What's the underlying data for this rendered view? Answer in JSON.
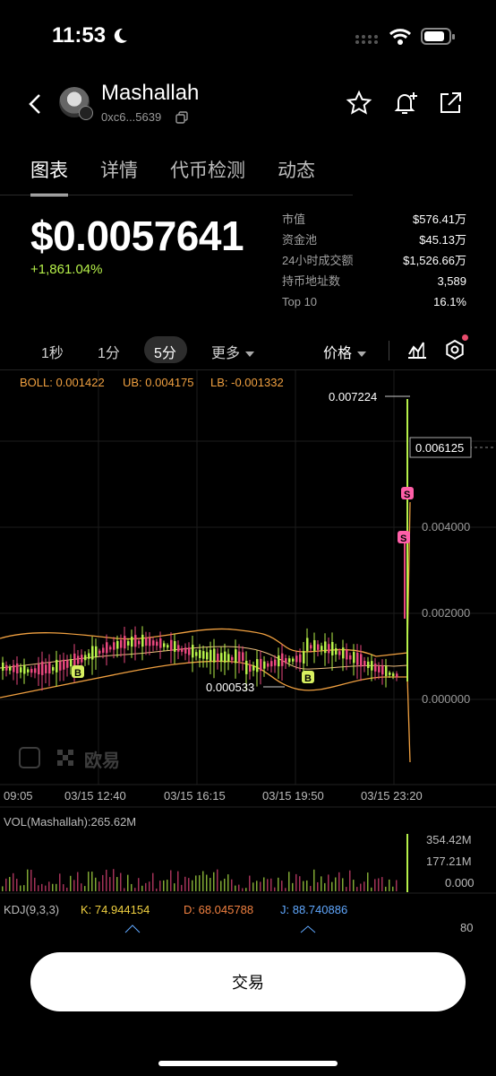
{
  "status": {
    "time": "11:53"
  },
  "header": {
    "name": "Mashallah",
    "address": "0xc6...5639"
  },
  "tabs": [
    {
      "label": "图表",
      "active": true
    },
    {
      "label": "详情",
      "active": false
    },
    {
      "label": "代币检测",
      "active": false
    },
    {
      "label": "动态",
      "active": false
    }
  ],
  "price": {
    "value": "$0.0057641",
    "change": "+1,861.04%",
    "change_color": "#b6f04a"
  },
  "stats": [
    {
      "label": "市值",
      "value": "$576.41万"
    },
    {
      "label": "资金池",
      "value": "$45.13万"
    },
    {
      "label": "24小时成交额",
      "value": "$1,526.66万"
    },
    {
      "label": "持币地址数",
      "value": "3,589"
    },
    {
      "label": "Top 10",
      "value": "16.1%"
    }
  ],
  "timeframes": {
    "t1": "1秒",
    "t2": "1分",
    "t3": "5分",
    "more": "更多",
    "price_type": "价格"
  },
  "indicators": {
    "boll": "BOLL: 0.001422",
    "ub": "UB: 0.004175",
    "lb": "LB: -0.001332",
    "vol": "VOL(Mashallah):265.62M",
    "kdj_label": "KDJ(9,3,3)",
    "kdj_k": "K: 74.944154",
    "kdj_d": "D: 68.045788",
    "kdj_j": "J: 88.740886"
  },
  "chart": {
    "y_ticks": [
      "0.004000",
      "0.002000",
      "0.000000"
    ],
    "max_label": "0.007224",
    "min_label": "0.000533",
    "current_label": "0.006125",
    "x_ticks": [
      "09:05",
      "03/15 12:40",
      "03/15 16:15",
      "03/15 19:50",
      "03/15 23:20"
    ],
    "vol_ticks": [
      "354.42M",
      "177.21M",
      "0.000"
    ],
    "kdj_tick": "80",
    "watermark": "欧易",
    "buy_marker": "B",
    "sell_marker": "S",
    "colors": {
      "up": "#b6f04a",
      "down": "#e8477e",
      "boll": "#f0a040"
    }
  },
  "chart_data": {
    "type": "line",
    "title": "",
    "series": [
      {
        "name": "BOLL",
        "values": [
          0.001422
        ]
      },
      {
        "name": "UB",
        "values": [
          0.004175
        ]
      },
      {
        "name": "LB",
        "values": [
          -0.001332
        ]
      }
    ],
    "x": [
      "09:05",
      "03/15 12:40",
      "03/15 16:15",
      "03/15 19:50",
      "03/15 23:20"
    ],
    "ylim": [
      0,
      0.0072
    ],
    "annotations": [
      "0.007224",
      "0.000533",
      "0.006125"
    ]
  },
  "trade_button": "交易"
}
